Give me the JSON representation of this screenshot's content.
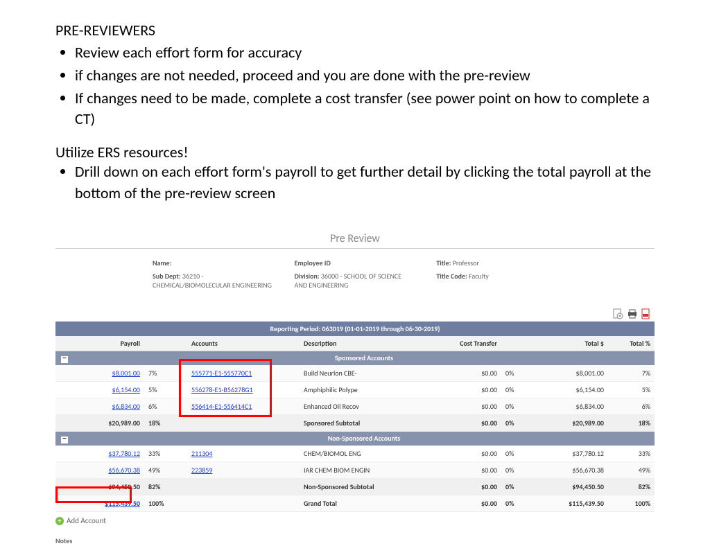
{
  "doc": {
    "heading": "PRE-REVIEWERS",
    "bullets": [
      "Review each effort form for accuracy",
      "if changes are not needed, proceed and you are done with the pre-review",
      "If changes need to be made, complete a cost transfer (see power point on how to complete a CT)"
    ],
    "resources_heading": "Utilize ERS resources!",
    "resources_bullets": [
      "Drill down on each effort form's payroll to get further detail by clicking the total payroll at the bottom of the pre-review screen"
    ]
  },
  "app": {
    "title": "Pre Review",
    "meta": {
      "name_label": "Name:",
      "sub_dept_label": "Sub Dept:",
      "sub_dept": "36210 - CHEMICAL/BIOMOLECULAR ENGINEERING",
      "emp_id_label": "Employee ID",
      "division_label": "Division:",
      "division": "36000 - SCHOOL OF SCIENCE AND ENGINEERING",
      "title_label": "Title:",
      "title": "Professor",
      "title_code_label": "Title Code:",
      "title_code": "Faculty"
    },
    "reporting_period": "Reporting Period: 063019 (01-01-2019 through 06-30-2019)",
    "columns": {
      "payroll": "Payroll",
      "accounts": "Accounts",
      "description": "Description",
      "cost_transfer": "Cost Transfer",
      "total_dollar": "Total $",
      "total_pct": "Total %"
    },
    "sections": {
      "sponsored": "Sponsored Accounts",
      "nonsponsored": "Non-Sponsored Accounts"
    },
    "sponsored_rows": [
      {
        "payroll": "$8,001.00",
        "pct": "7%",
        "account": "555771-E1-555770C1",
        "desc": "Build Neurlon CBE-",
        "ct_amt": "$0.00",
        "ct_pct": "0%",
        "tot": "$8,001.00",
        "tot_pct": "7%"
      },
      {
        "payroll": "$6,154.00",
        "pct": "5%",
        "account": "556278-E1-B56278G1",
        "desc": "Amphiphilic Polype",
        "ct_amt": "$0.00",
        "ct_pct": "0%",
        "tot": "$6,154.00",
        "tot_pct": "5%"
      },
      {
        "payroll": "$6,834.00",
        "pct": "6%",
        "account": "556414-E1-556414C1",
        "desc": "Enhanced Oil Recov",
        "ct_amt": "$0.00",
        "ct_pct": "0%",
        "tot": "$6,834.00",
        "tot_pct": "6%"
      }
    ],
    "sponsored_subtotal": {
      "payroll": "$20,989.00",
      "pct": "18%",
      "desc": "Sponsored Subtotal",
      "ct_amt": "$0.00",
      "ct_pct": "0%",
      "tot": "$20,989.00",
      "tot_pct": "18%"
    },
    "nonsponsored_rows": [
      {
        "payroll": "$37,780.12",
        "pct": "33%",
        "account": "211304",
        "desc": "CHEM/BIOMOL ENG",
        "ct_amt": "$0.00",
        "ct_pct": "0%",
        "tot": "$37,780.12",
        "tot_pct": "33%"
      },
      {
        "payroll": "$56,670.38",
        "pct": "49%",
        "account": "223859",
        "desc": "IAR CHEM BIOM ENGIN",
        "ct_amt": "$0.00",
        "ct_pct": "0%",
        "tot": "$56,670.38",
        "tot_pct": "49%"
      }
    ],
    "nonsponsored_subtotal": {
      "payroll": "$94,450.50",
      "pct": "82%",
      "desc": "Non-Sponsored Subtotal",
      "ct_amt": "$0.00",
      "ct_pct": "0%",
      "tot": "$94,450.50",
      "tot_pct": "82%"
    },
    "grand_total": {
      "payroll": "$115,439.50",
      "pct": "100%",
      "desc": "Grand Total",
      "ct_amt": "$0.00",
      "ct_pct": "0%",
      "tot": "$115,439.50",
      "tot_pct": "100%"
    },
    "add_account": "Add Account",
    "notes": "Notes"
  }
}
